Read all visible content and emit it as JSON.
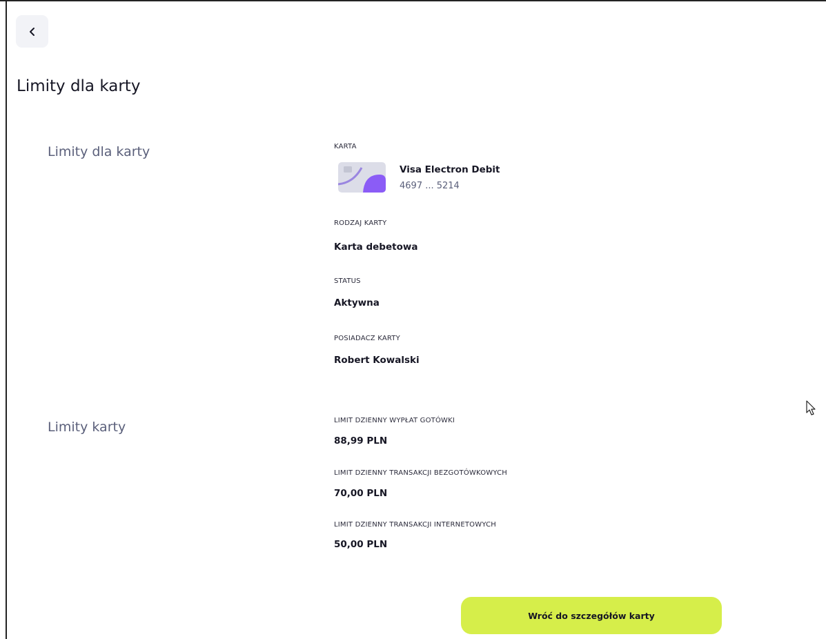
{
  "header": {
    "back_icon": "chevron-left-icon",
    "title": "Limity dla karty"
  },
  "card_section": {
    "title": "Limity dla karty",
    "card_label": "KARTA",
    "card_name": "Visa Electron Debit",
    "card_number": "4697 ... 5214",
    "card_type_label": "RODZAJ KARTY",
    "card_type_value": "Karta debetowa",
    "status_label": "STATUS",
    "status_value": "Aktywna",
    "holder_label": "POSIADACZ KARTY",
    "holder_value": "Robert Kowalski"
  },
  "limits_section": {
    "title": "Limity karty",
    "cash_label": "LIMIT DZIENNY WYPŁAT GOTÓWKI",
    "cash_value": "88,99 PLN",
    "cashless_label": "LIMIT DZIENNY TRANSAKCJI BEZGOTÓWKOWYCH",
    "cashless_value": "70,00 PLN",
    "internet_label": "LIMIT DZIENNY TRANSAKCJI INTERNETOWYCH",
    "internet_value": "50,00 PLN"
  },
  "actions": {
    "back_to_details": "Wróć do szczegółów karty"
  },
  "colors": {
    "accent": "#d6ee4a",
    "card_purple": "#8b5cf6",
    "section_title": "#5a5f7a"
  }
}
